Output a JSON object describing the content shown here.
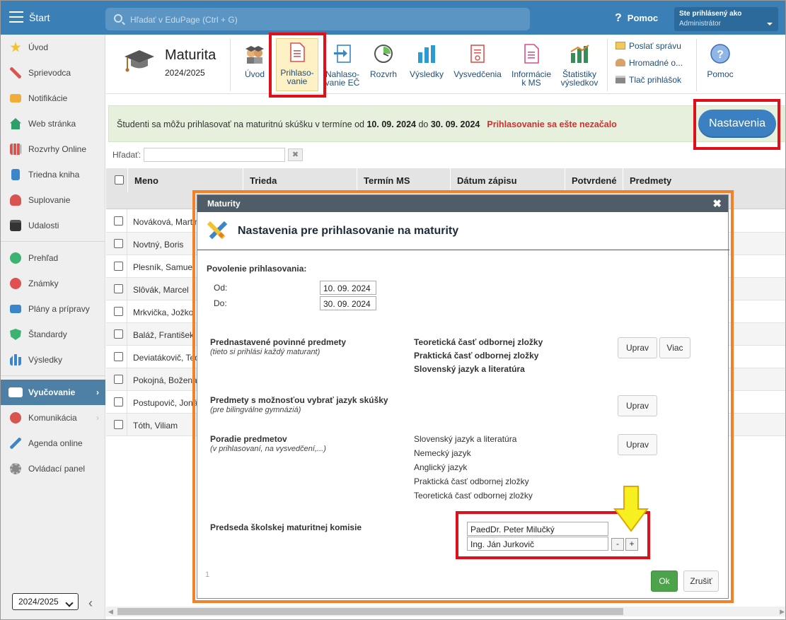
{
  "topbar": {
    "start": "Štart",
    "search_placeholder": "Hľadať v EduPage (Ctrl + G)",
    "help": "Pomoc",
    "user_line1": "Ste prihlásený ako",
    "user_line2": "Administrátor"
  },
  "sidebar": {
    "items": [
      "Úvod",
      "Sprievodca",
      "Notifikácie",
      "Web stránka",
      "Rozvrhy Online",
      "Triedna kniha",
      "Suplovanie",
      "Udalosti",
      "Prehľad",
      "Známky",
      "Plány a prípravy",
      "Štandardy",
      "Výsledky",
      "Vyučovanie",
      "Komunikácia",
      "Agenda online",
      "Ovládací panel"
    ],
    "year": "2024/2025"
  },
  "ribbon": {
    "title": "Maturita",
    "year": "2024/2025",
    "buttons": [
      "Úvod",
      "Prihlaso-\nvanie",
      "Nahlaso-\nvanie EČ",
      "Rozvrh",
      "Výsledky",
      "Vysvedčenia",
      "Informácie\nk MS",
      "Štatistiky\nvýsledkov"
    ],
    "small": [
      "Poslať správu",
      "Hromadné o...",
      "Tlač prihlášok"
    ],
    "help": "Pomoc"
  },
  "info": {
    "text_pre": "Študenti sa môžu prihlasovať na maturitnú skúšku v termíne od ",
    "date_from": "10. 09. 2024",
    "text_mid": " do ",
    "date_to": "30. 09. 2024",
    "warning": "Prihlasovanie sa ešte nezačalo",
    "settings_button": "Nastavenia"
  },
  "filter": {
    "label": "Hľadať:",
    "clear": "✖"
  },
  "table": {
    "headers": [
      "Meno",
      "Trieda",
      "Termín MS",
      "Dátum zápisu",
      "Potvrdené",
      "Predmety"
    ],
    "rows": [
      "Nováková, Martina",
      "Novtný, Boris",
      "Plesník, Samuel",
      "Slôvák, Marcel",
      "Mrkvička, Jožko",
      "Baláž, František",
      "Deviatákovič, Teo",
      "Pokojná, Božena",
      "Postupovič, Jonáš",
      "Tóth, Viliam"
    ]
  },
  "modal": {
    "header": "Maturity",
    "close": "✖",
    "title": "Nastavenia pre prihlasovanie na maturity",
    "povolenie": "Povolenie prihlasovania:",
    "od_label": "Od:",
    "do_label": "Do:",
    "od_value": "10. 09. 2024",
    "do_value": "30. 09. 2024",
    "sec1_title": "Prednastavené povinné predmety",
    "sec1_sub": "(tieto si prihlási každý maturant)",
    "sec1_items": [
      "Teoretická časť odbornej zložky",
      "Praktická časť odbornej zložky",
      "Slovenský jazyk a literatúra"
    ],
    "uprav": "Uprav",
    "viac": "Viac",
    "sec2_title": "Predmety s možnosťou vybrať jazyk skúšky",
    "sec2_sub": "(pre bilingválne gymnáziá)",
    "sec3_title": "Poradie predmetov",
    "sec3_sub": "(v prihlasovaní, na vysvedčení,...)",
    "sec3_items": [
      "Slovenský jazyk a literatúra",
      "Nemecký jazyk",
      "Anglický jazyk",
      "Praktická časť odbornej zložky",
      "Teoretická časť odbornej zložky"
    ],
    "sec4_title": "Predseda školskej maturitnej komisie",
    "chairs": [
      "PaedDr. Peter Milučký",
      "Ing. Ján Jurkovič"
    ],
    "minus": "-",
    "plus": "+",
    "page": "1",
    "ok": "Ok",
    "cancel": "Zrušiť"
  }
}
